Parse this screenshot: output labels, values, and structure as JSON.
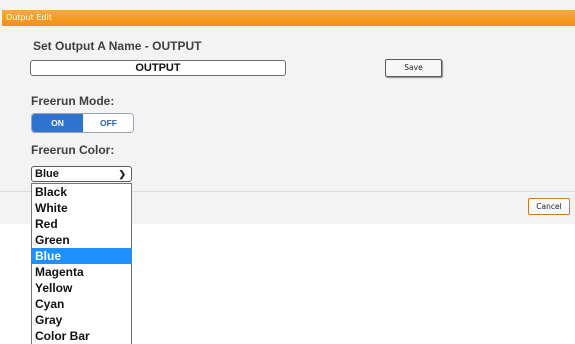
{
  "dialog": {
    "title": "Output Edit",
    "name_label": "Set Output A Name - OUTPUT",
    "name_value": "OUTPUT",
    "save_label": "Save",
    "freerun_mode_label": "Freerun Mode:",
    "toggle_on": "ON",
    "toggle_off": "OFF",
    "freerun_color_label": "Freerun Color:",
    "selected_color": "Blue",
    "cancel_label": "Cancel"
  },
  "color_options": [
    "Black",
    "White",
    "Red",
    "Green",
    "Blue",
    "Magenta",
    "Yellow",
    "Cyan",
    "Gray",
    "Color Bar"
  ],
  "colors": {
    "titlebar": "#f29a22",
    "toggle_active": "#2e72d2",
    "option_highlight": "#1e90ff"
  }
}
